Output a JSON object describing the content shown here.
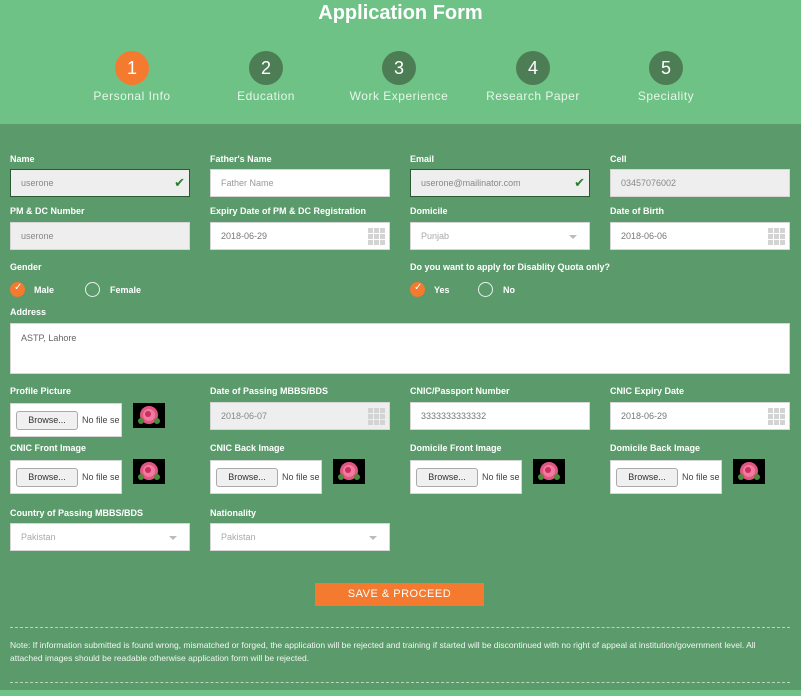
{
  "title": "Application Form",
  "steps": [
    {
      "number": "1",
      "label": "Personal Info",
      "active": true
    },
    {
      "number": "2",
      "label": "Education",
      "active": false
    },
    {
      "number": "3",
      "label": "Work Experience",
      "active": false
    },
    {
      "number": "4",
      "label": "Research Paper",
      "active": false
    },
    {
      "number": "5",
      "label": "Speciality",
      "active": false
    }
  ],
  "fields": {
    "name": {
      "label": "Name",
      "value": "userone"
    },
    "fathers_name": {
      "label": "Father's Name",
      "placeholder": "Father Name"
    },
    "email": {
      "label": "Email",
      "value": "userone@mailinator.com"
    },
    "cell": {
      "label": "Cell",
      "value": "03457076002"
    },
    "pmdc_number": {
      "label": "PM & DC Number",
      "value": "userone"
    },
    "pmdc_expiry": {
      "label": "Expiry Date of PM & DC Registration",
      "value": "2018-06-29"
    },
    "domicile": {
      "label": "Domicile",
      "value": "Punjab"
    },
    "dob": {
      "label": "Date of Birth",
      "value": "2018-06-06"
    },
    "gender": {
      "label": "Gender",
      "options": [
        "Male",
        "Female"
      ],
      "selected": "Male"
    },
    "disability": {
      "label": "Do you want to apply for Disablity Quota only?",
      "options": [
        "Yes",
        "No"
      ],
      "selected": "Yes"
    },
    "address": {
      "label": "Address",
      "value": "ASTP, Lahore"
    },
    "profile_picture": {
      "label": "Profile Picture"
    },
    "mbbs_date": {
      "label": "Date of Passing MBBS/BDS",
      "value": "2018-06-07"
    },
    "cnic": {
      "label": "CNIC/Passport Number",
      "value": "3333333333332"
    },
    "cnic_expiry": {
      "label": "CNIC Expiry Date",
      "value": "2018-06-29"
    },
    "cnic_front": {
      "label": "CNIC Front Image"
    },
    "cnic_back": {
      "label": "CNIC Back Image"
    },
    "domicile_front": {
      "label": "Domicile Front Image"
    },
    "domicile_back": {
      "label": "Domicile Back Image"
    },
    "country_mbbs": {
      "label": "Country of Passing MBBS/BDS",
      "value": "Pakistan"
    },
    "nationality": {
      "label": "Nationality",
      "value": "Pakistan"
    }
  },
  "file_input": {
    "browse_label": "Browse...",
    "status": "No file selected."
  },
  "save_button": "SAVE & PROCEED",
  "note": "Note: If information submitted is found wrong, mismatched or forged, the application will be rejected and training if started will be discontinued with no right of appeal at institution/government level. All attached images should be readable otherwise application form will be rejected.",
  "colors": {
    "header_green": "#6ec285",
    "form_green": "#5b9a6b",
    "accent_orange": "#f47a30",
    "step_dark": "#4c7d55"
  }
}
